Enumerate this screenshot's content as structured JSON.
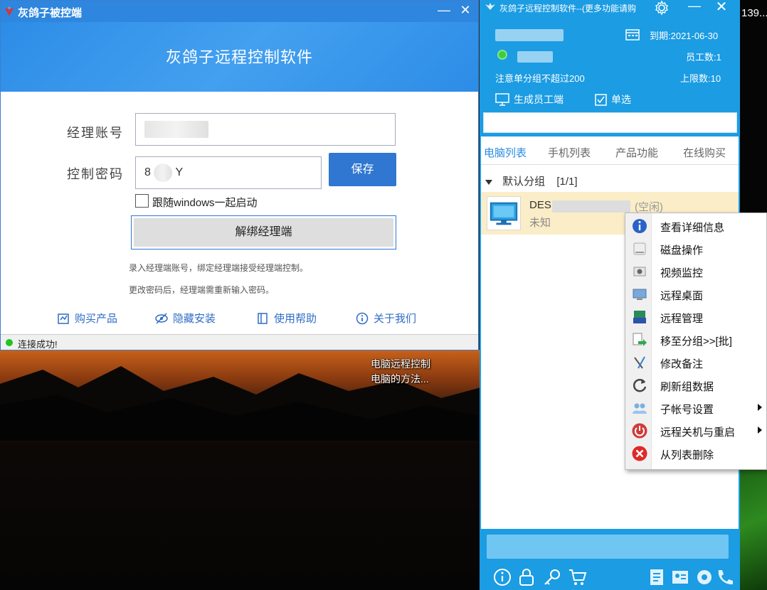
{
  "desktop": {
    "overlay_text_line1": "电脑远程控制",
    "overlay_text_line2": "电脑的方法...",
    "edge_number": "139..."
  },
  "left_window": {
    "title": "灰鸽子被控端",
    "minimize": "—",
    "close": "✕",
    "banner_title": "灰鸽子远程控制软件",
    "manager_account_label": "经理账号",
    "manager_account_value": "",
    "control_password_label": "控制密码",
    "control_password_value": "8",
    "control_password_value_tail": "Y",
    "save_label": "保存",
    "autostart_label": "跟随windows一起启动",
    "autostart_checked": false,
    "unbind_label": "解绑经理端",
    "note1": "录入经理端账号，绑定经理端接受经理端控制。",
    "note2": "更改密码后，经理端需重新输入密码。",
    "links": {
      "buy": "购买产品",
      "hide_install": "隐藏安装",
      "help": "使用帮助",
      "about": "关于我们"
    },
    "status_text": "连接成功!"
  },
  "right_window": {
    "title": "灰鸽子远程控制软件--(更多功能请购",
    "expiry": "到期:2021-06-30",
    "staff_count": "员工数:1",
    "group_note": "注意单分组不超过200",
    "limit": "上限数:10",
    "generate_client": "生成员工端",
    "single_select": "单选",
    "tabs": [
      "电脑列表",
      "手机列表",
      "产品功能",
      "在线购买"
    ],
    "group_name": "默认分组",
    "group_count": "[1/1]",
    "device_name": "DES",
    "device_state": "(空闲)",
    "device_sub": "未知"
  },
  "context_menu": {
    "items": [
      {
        "label": "查看详细信息",
        "submenu": false
      },
      {
        "label": "磁盘操作",
        "submenu": false
      },
      {
        "label": "视频监控",
        "submenu": false
      },
      {
        "label": "远程桌面",
        "submenu": false
      },
      {
        "label": "远程管理",
        "submenu": false
      },
      {
        "label": "移至分组>>[批]",
        "submenu": false
      },
      {
        "label": "修改备注",
        "submenu": false
      },
      {
        "label": "刷新组数据",
        "submenu": false
      },
      {
        "label": "子帐号设置",
        "submenu": true
      },
      {
        "label": "远程关机与重启",
        "submenu": true
      },
      {
        "label": "从列表删除",
        "submenu": false
      }
    ]
  },
  "colors": {
    "accent_blue": "#2e86de",
    "panel_blue": "#1b9ce3",
    "save_button": "#2f77d0",
    "selected_row": "#fbedc7",
    "online_green": "#22c322"
  }
}
